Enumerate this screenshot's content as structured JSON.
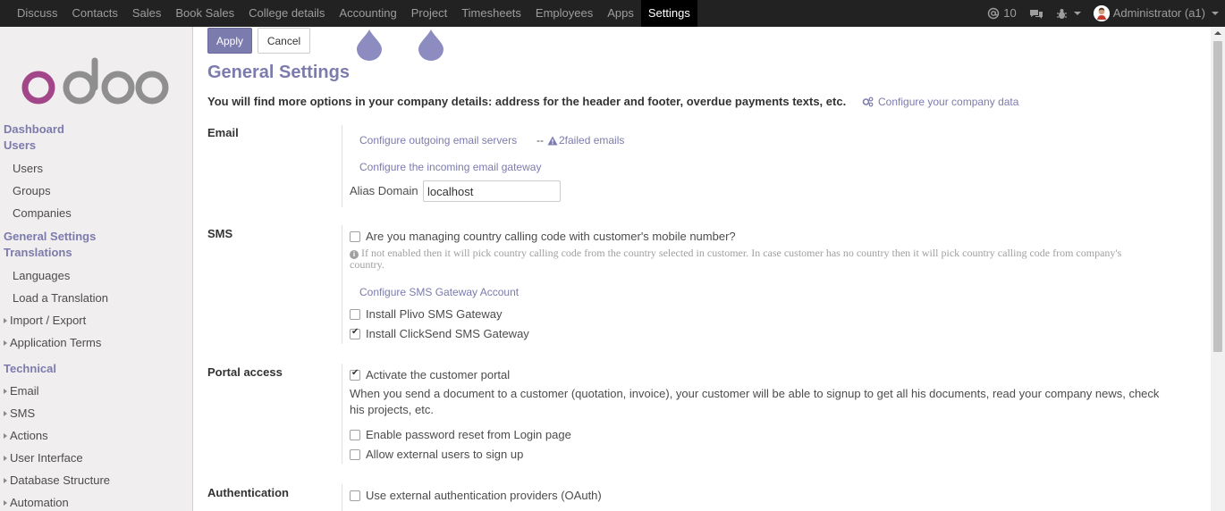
{
  "navbar": {
    "menu": [
      "Discuss",
      "Contacts",
      "Sales",
      "Book Sales",
      "College details",
      "Accounting",
      "Project",
      "Timesheets",
      "Employees",
      "Apps",
      "Settings"
    ],
    "active": "Settings",
    "mentions_count": "10",
    "user": "Administrator (a1)"
  },
  "sidebar": {
    "dashboard": "Dashboard",
    "users_section": "Users",
    "users_items": [
      "Users",
      "Groups",
      "Companies"
    ],
    "general_settings": "General Settings",
    "translations": "Translations",
    "translations_items": [
      "Languages",
      "Load a Translation"
    ],
    "import_export": "Import / Export",
    "application_terms": "Application Terms",
    "technical": "Technical",
    "technical_items": [
      "Email",
      "SMS",
      "Actions",
      "User Interface",
      "Database Structure",
      "Automation"
    ]
  },
  "toolbar": {
    "apply": "Apply",
    "cancel": "Cancel"
  },
  "page": {
    "title": "General Settings",
    "intro": "You will find more options in your company details: address for the header and footer, overdue payments texts, etc.",
    "company_link": "Configure your company data"
  },
  "email": {
    "label": "Email",
    "outgoing_link": "Configure outgoing email servers",
    "separator": "--",
    "failed_emails": "2failed emails",
    "incoming_link": "Configure the incoming email gateway",
    "alias_label": "Alias Domain",
    "alias_value": "localhost"
  },
  "sms": {
    "label": "SMS",
    "calling_code_label": "Are you managing country calling code with customer's mobile number?",
    "calling_code_help": "If not enabled then it will pick country calling code from the country selected in customer. In case customer has no country then it will pick country calling code from company's country.",
    "gateway_link": "Configure SMS Gateway Account",
    "plivo_label": "Install Plivo SMS Gateway",
    "clicksend_label": "Install ClickSend SMS Gateway"
  },
  "portal": {
    "label": "Portal access",
    "activate_label": "Activate the customer portal",
    "help": "When you send a document to a customer (quotation, invoice), your customer will be able to signup to get all his documents, read your company news, check his projects, etc.",
    "reset_label": "Enable password reset from Login page",
    "signup_label": "Allow external users to sign up"
  },
  "auth": {
    "label": "Authentication",
    "oauth_label": "Use external authentication providers (OAuth)"
  },
  "checkboxes": {
    "calling_code": false,
    "plivo": false,
    "clicksend": true,
    "portal": true,
    "reset": false,
    "signup": false,
    "oauth": false
  },
  "colors": {
    "accent": "#7c7bad",
    "navbar": "#222222",
    "sidebar": "#f0eeee"
  },
  "icons": {
    "mentions": "at-icon",
    "chat": "comments-icon",
    "debug": "bug-icon",
    "company_link": "gears-icon",
    "failed_emails": "warning-icon",
    "help": "info-circle-icon"
  }
}
